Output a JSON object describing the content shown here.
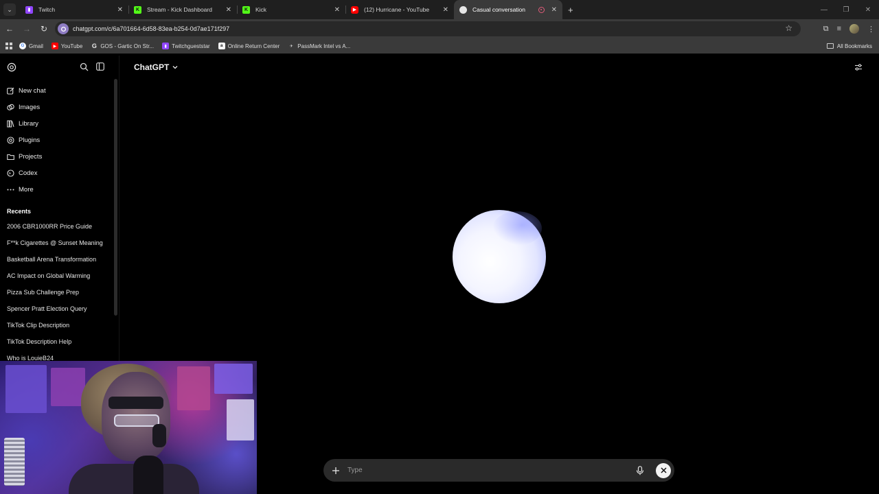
{
  "browser": {
    "tabs": [
      {
        "title": "Twitch",
        "icon": "twitch-icon",
        "color": "#9146ff"
      },
      {
        "title": "Stream - Kick Dashboard",
        "icon": "kick-icon",
        "color": "#53fc18"
      },
      {
        "title": "Kick",
        "icon": "kick-icon",
        "color": "#53fc18"
      },
      {
        "title": "(12) Hurricane - YouTube",
        "icon": "youtube-icon",
        "color": "#ff0000"
      },
      {
        "title": "Casual conversation",
        "icon": "chatgpt-icon",
        "color": "#cfcfcf",
        "active": true
      }
    ],
    "url": "chatgpt.com/c/6a701664-6d58-83ea-b254-0d7ae171f297",
    "bookmarks": [
      {
        "label": "Gmail",
        "icon": "gmail-icon"
      },
      {
        "label": "YouTube",
        "icon": "youtube-icon"
      },
      {
        "label": "GOS - Gartic On Str...",
        "icon": "google-icon"
      },
      {
        "label": "Twitchgueststar",
        "icon": "twitch-icon"
      },
      {
        "label": "Online Return Center",
        "icon": "amazon-icon"
      },
      {
        "label": "PassMark Intel vs A...",
        "icon": "passmark-icon"
      }
    ],
    "all_bookmarks": "All Bookmarks"
  },
  "sidebar": {
    "nav": [
      {
        "label": "New chat",
        "icon": "new-chat-icon"
      },
      {
        "label": "Images",
        "icon": "images-icon"
      },
      {
        "label": "Library",
        "icon": "library-icon"
      },
      {
        "label": "Plugins",
        "icon": "plugins-icon"
      },
      {
        "label": "Projects",
        "icon": "projects-icon"
      },
      {
        "label": "Codex",
        "icon": "codex-icon"
      },
      {
        "label": "More",
        "icon": "more-icon"
      }
    ],
    "recents_label": "Recents",
    "recents": [
      "2006 CBR1000RR Price Guide",
      "F**k Cigarettes @ Sunset Meaning",
      "Basketball Arena Transformation",
      "AC Impact on Global Warming",
      "Pizza Sub Challenge Prep",
      "Spencer Pratt Election Query",
      "TikTok Clip Description",
      "TikTok Description Help",
      "Who is LouieB24"
    ]
  },
  "main": {
    "model_label": "ChatGPT",
    "composer_placeholder": "Type"
  },
  "colors": {
    "background": "#000000",
    "orb_core": "#f4f5ff",
    "orb_edge": "#8f97ff",
    "composer_bg": "#2a2a2a"
  }
}
